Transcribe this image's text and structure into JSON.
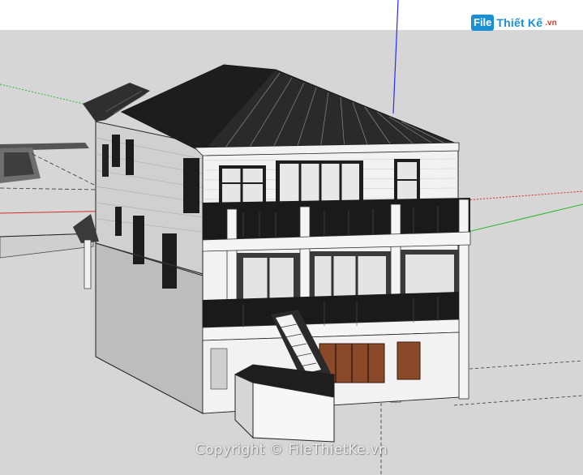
{
  "watermark": {
    "logo_badge": "File",
    "logo_text": "Thiết Kế",
    "logo_domain": ".vn",
    "copyright": "Copyright © FileThietKe.vn"
  },
  "colors": {
    "sky": "#ffffff",
    "ground": "#d6d6d6",
    "axis_blue": "#2a2aff",
    "axis_red": "#d42a2a",
    "axis_green": "#2ab82a",
    "roof": "#2b2b2b",
    "wall": "#f2f2f2",
    "shadow_wall": "#c9c9c9",
    "door_wood": "#8a4a2a",
    "logo_blue": "#1a8fd6"
  },
  "icons": {
    "logo": "filethietke-logo-icon"
  }
}
